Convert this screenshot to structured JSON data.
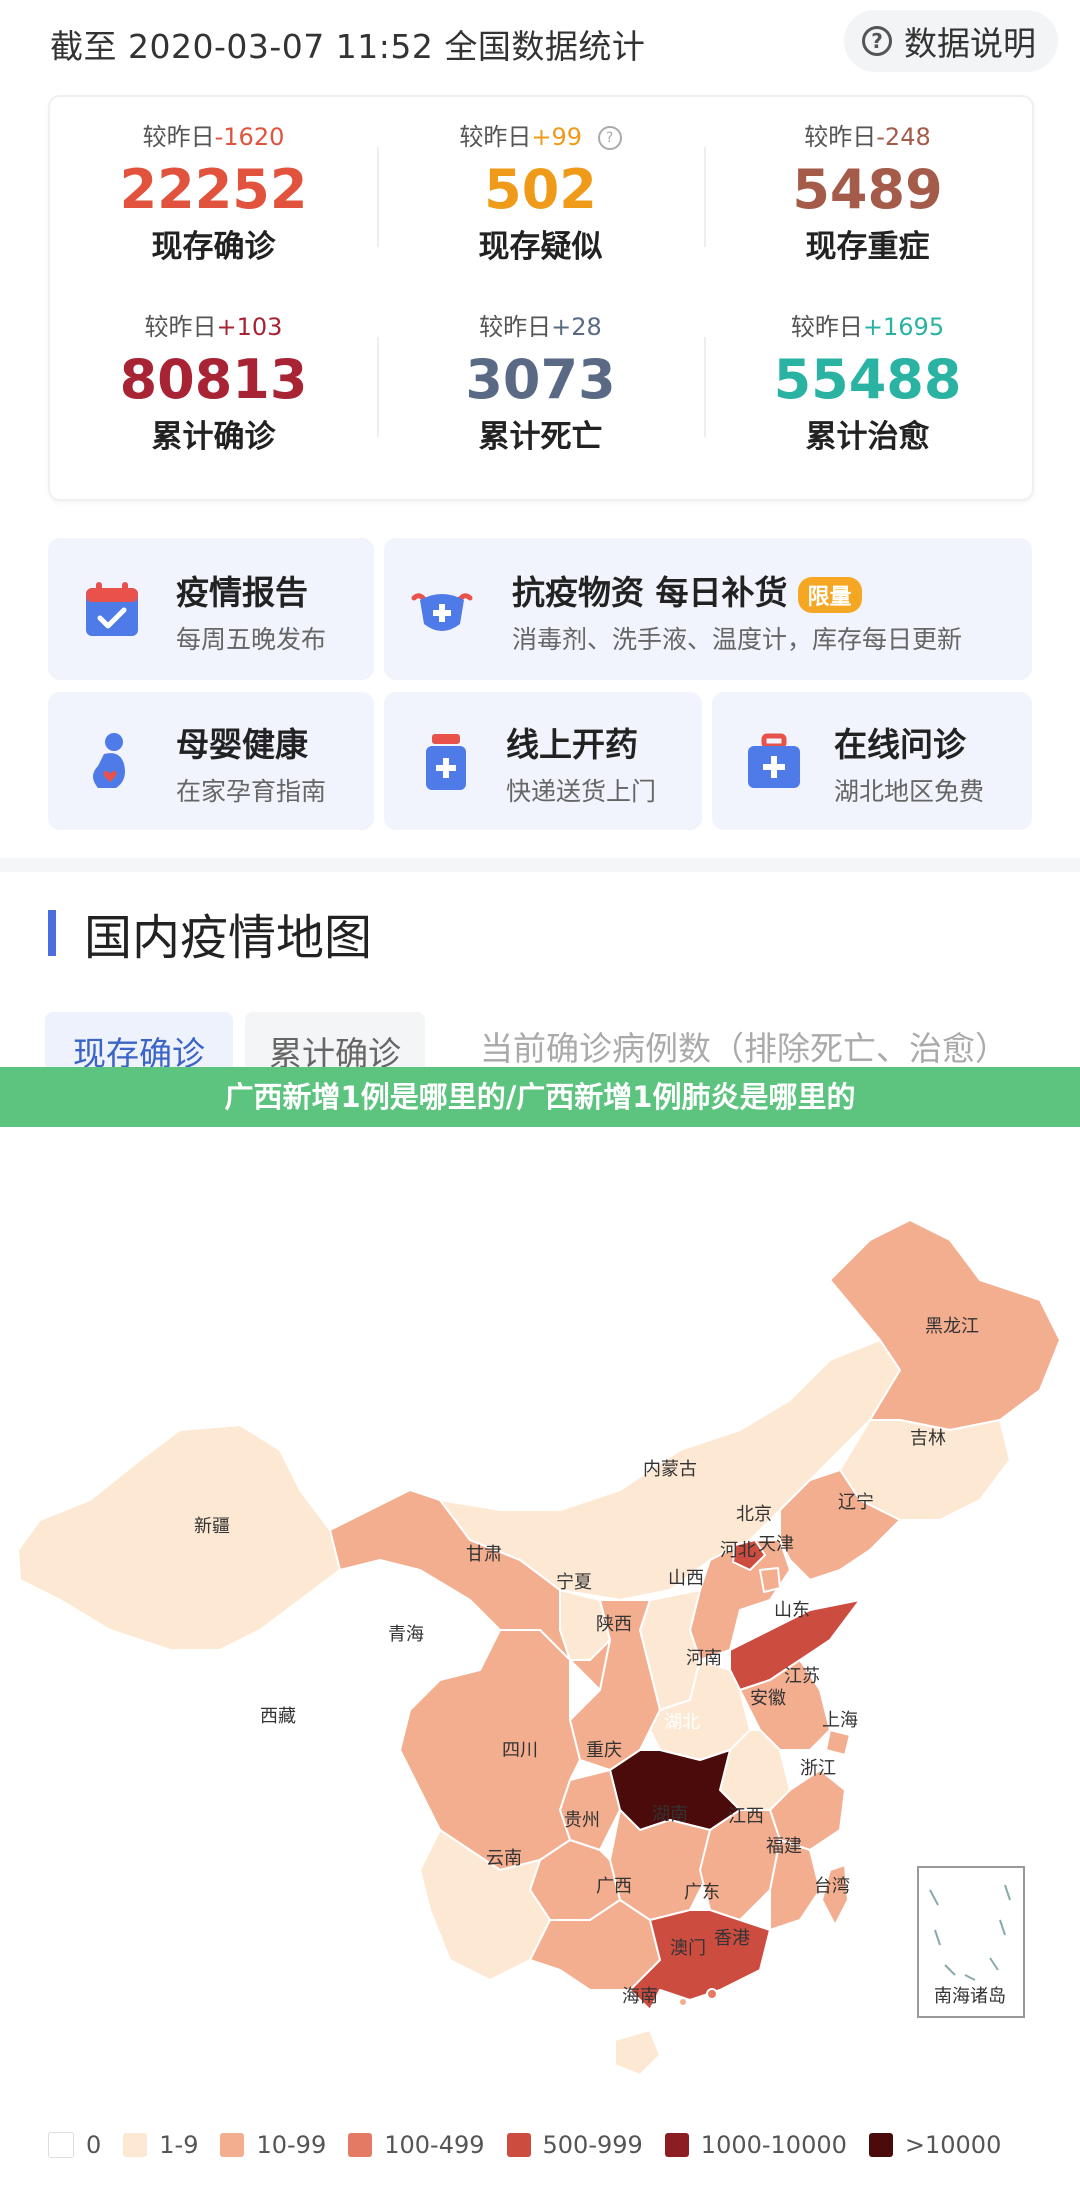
{
  "header": {
    "title": "截至 2020-03-07 11:52 全国数据统计",
    "explain_label": "数据说明"
  },
  "stats": [
    {
      "delta_prefix": "较昨日",
      "delta_value": "-1620",
      "delta_color": "#e2533e",
      "value": "22252",
      "value_color": "#e2533e",
      "label": "现存确诊"
    },
    {
      "delta_prefix": "较昨日",
      "delta_value": "+99",
      "delta_color": "#f09a1a",
      "value": "502",
      "value_color": "#f09a1a",
      "label": "现存疑似",
      "has_help_icon": true
    },
    {
      "delta_prefix": "较昨日",
      "delta_value": "-248",
      "delta_color": "#a55b4a",
      "value": "5489",
      "value_color": "#a55b4a",
      "label": "现存重症"
    },
    {
      "delta_prefix": "较昨日",
      "delta_value": "+103",
      "delta_color": "#a82434",
      "value": "80813",
      "value_color": "#a82434",
      "label": "累计确诊"
    },
    {
      "delta_prefix": "较昨日",
      "delta_value": "+28",
      "delta_color": "#5a6a85",
      "value": "3073",
      "value_color": "#5a6a85",
      "label": "累计死亡"
    },
    {
      "delta_prefix": "较昨日",
      "delta_value": "+1695",
      "delta_color": "#2ab3a3",
      "value": "55488",
      "value_color": "#2ab3a3",
      "label": "累计治愈"
    }
  ],
  "tiles": [
    {
      "title": "疫情报告",
      "subtitle": "每周五晚发布",
      "icon": "calendar-check-icon"
    },
    {
      "title": "抗疫物资 每日补货",
      "badge": "限量",
      "subtitle": "消毒剂、洗手液、温度计，库存每日更新",
      "icon": "mask-plus-icon"
    },
    {
      "title": "母婴健康",
      "subtitle": "在家孕育指南",
      "icon": "mother-baby-icon"
    },
    {
      "title": "线上开药",
      "subtitle": "快递送货上门",
      "icon": "medicine-bottle-icon"
    },
    {
      "title": "在线问诊",
      "subtitle": "湖北地区免费",
      "icon": "medical-kit-icon"
    }
  ],
  "section": {
    "title": "国内疫情地图"
  },
  "tabs": {
    "active": "现存确诊",
    "inactive": "累计确诊",
    "note": "当前确诊病例数（排除死亡、治愈）"
  },
  "banner": {
    "text": "广西新增1例是哪里的/广西新增1例肺炎是哪里的"
  },
  "map": {
    "provinces": {
      "xinjiang": "新疆",
      "xizang": "西藏",
      "qinghai": "青海",
      "gansu": "甘肃",
      "neimenggu": "内蒙古",
      "heilongjiang": "黑龙江",
      "jilin": "吉林",
      "liaoning": "辽宁",
      "beijing": "北京",
      "tianjin": "天津",
      "hebei": "河北",
      "shanxi": "山西",
      "ningxia": "宁夏",
      "shaanxi": "陕西",
      "shandong": "山东",
      "henan": "河南",
      "jiangsu": "江苏",
      "anhui": "安徽",
      "shanghai": "上海",
      "hubei": "湖北",
      "sichuan": "四川",
      "chongqing": "重庆",
      "zhejiang": "浙江",
      "hunan": "湖南",
      "jiangxi": "江西",
      "guizhou": "贵州",
      "fujian": "福建",
      "yunnan": "云南",
      "guangxi": "广西",
      "guangdong": "广东",
      "taiwan": "台湾",
      "aomen": "澳门",
      "xianggang": "香港",
      "hainan": "海南",
      "nanhai": "南海诸岛"
    },
    "colors": {
      "c0": "#ffffff",
      "c1": "#fde9d3",
      "c2": "#f3ad8f",
      "c3": "#e47a63",
      "c4": "#cc4c40",
      "c5": "#8c1d22",
      "c6": "#4b0b0b"
    }
  },
  "legend": [
    {
      "label": "0",
      "color": "#ffffff"
    },
    {
      "label": "1-9",
      "color": "#fde9d3"
    },
    {
      "label": "10-99",
      "color": "#f3ad8f"
    },
    {
      "label": "100-499",
      "color": "#e47a63"
    },
    {
      "label": "500-999",
      "color": "#cc4c40"
    },
    {
      "label": "1000-10000",
      "color": "#8c1d22"
    },
    {
      "label": ">10000",
      "color": "#4b0b0b"
    }
  ]
}
